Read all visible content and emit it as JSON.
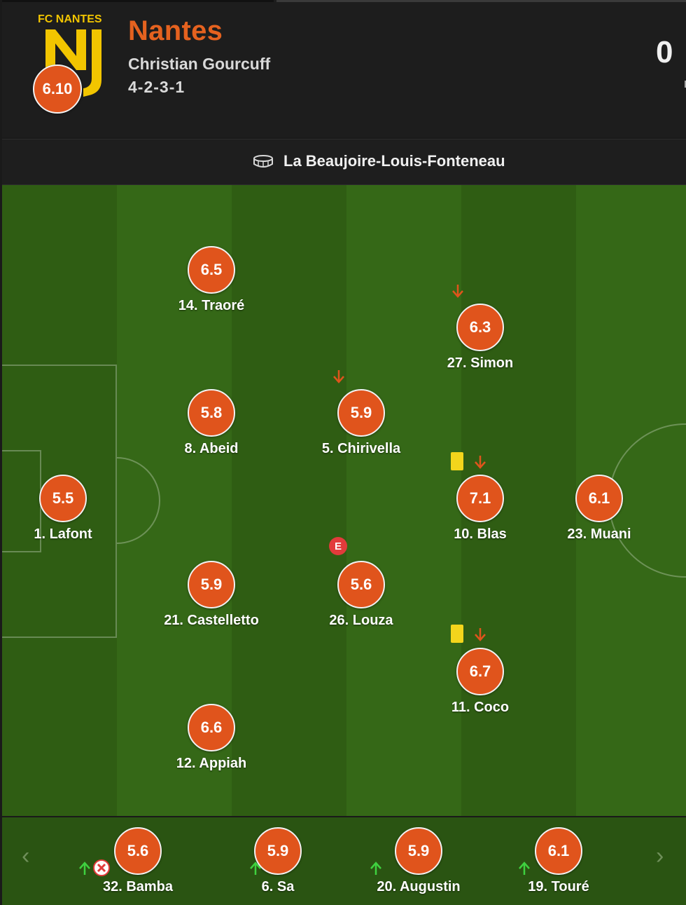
{
  "team": {
    "name": "Nantes",
    "coach": "Christian Gourcuff",
    "formation": "4-2-3-1",
    "average_rating": "6.10",
    "logo_text": "FC NANTES",
    "score": "0"
  },
  "venue": {
    "name": "La Beaujoire-Louis-Fonteneau",
    "icon": "stadium-icon"
  },
  "colors": {
    "rating_bg": "#e0541c",
    "pitch_dark": "#2f5d13",
    "pitch_light": "#366a17",
    "team_name": "#e5621f",
    "sub_down": "#e0541c",
    "sub_up": "#3fd13f",
    "yellow_card": "#f3d51c"
  },
  "players": [
    {
      "id": "lafont",
      "label": "1. Lafont",
      "rating": "5.5"
    },
    {
      "id": "traore",
      "label": "14. Traoré",
      "rating": "6.5"
    },
    {
      "id": "abeid",
      "label": "8. Abeid",
      "rating": "5.8"
    },
    {
      "id": "castelletto",
      "label": "21. Castelletto",
      "rating": "5.9"
    },
    {
      "id": "appiah",
      "label": "12. Appiah",
      "rating": "6.6"
    },
    {
      "id": "chirivella",
      "label": "5. Chirivella",
      "rating": "5.9",
      "subbed_off": true
    },
    {
      "id": "louza",
      "label": "26. Louza",
      "rating": "5.6",
      "event_badge": "E"
    },
    {
      "id": "simon",
      "label": "27. Simon",
      "rating": "6.3",
      "subbed_off": true
    },
    {
      "id": "blas",
      "label": "10. Blas",
      "rating": "7.1",
      "yellow_card": true,
      "subbed_off": true
    },
    {
      "id": "coco",
      "label": "11. Coco",
      "rating": "6.7",
      "yellow_card": true,
      "subbed_off": true
    },
    {
      "id": "muani",
      "label": "23. Muani",
      "rating": "6.1"
    }
  ],
  "bench": [
    {
      "id": "bamba",
      "label": "32. Bamba",
      "rating": "5.6",
      "subbed_on": true,
      "injured": true
    },
    {
      "id": "sa",
      "label": "6. Sa",
      "rating": "5.9",
      "subbed_on": true
    },
    {
      "id": "augustin",
      "label": "20. Augustin",
      "rating": "5.9",
      "subbed_on": true
    },
    {
      "id": "toure",
      "label": "19. Touré",
      "rating": "6.1",
      "subbed_on": true
    }
  ]
}
